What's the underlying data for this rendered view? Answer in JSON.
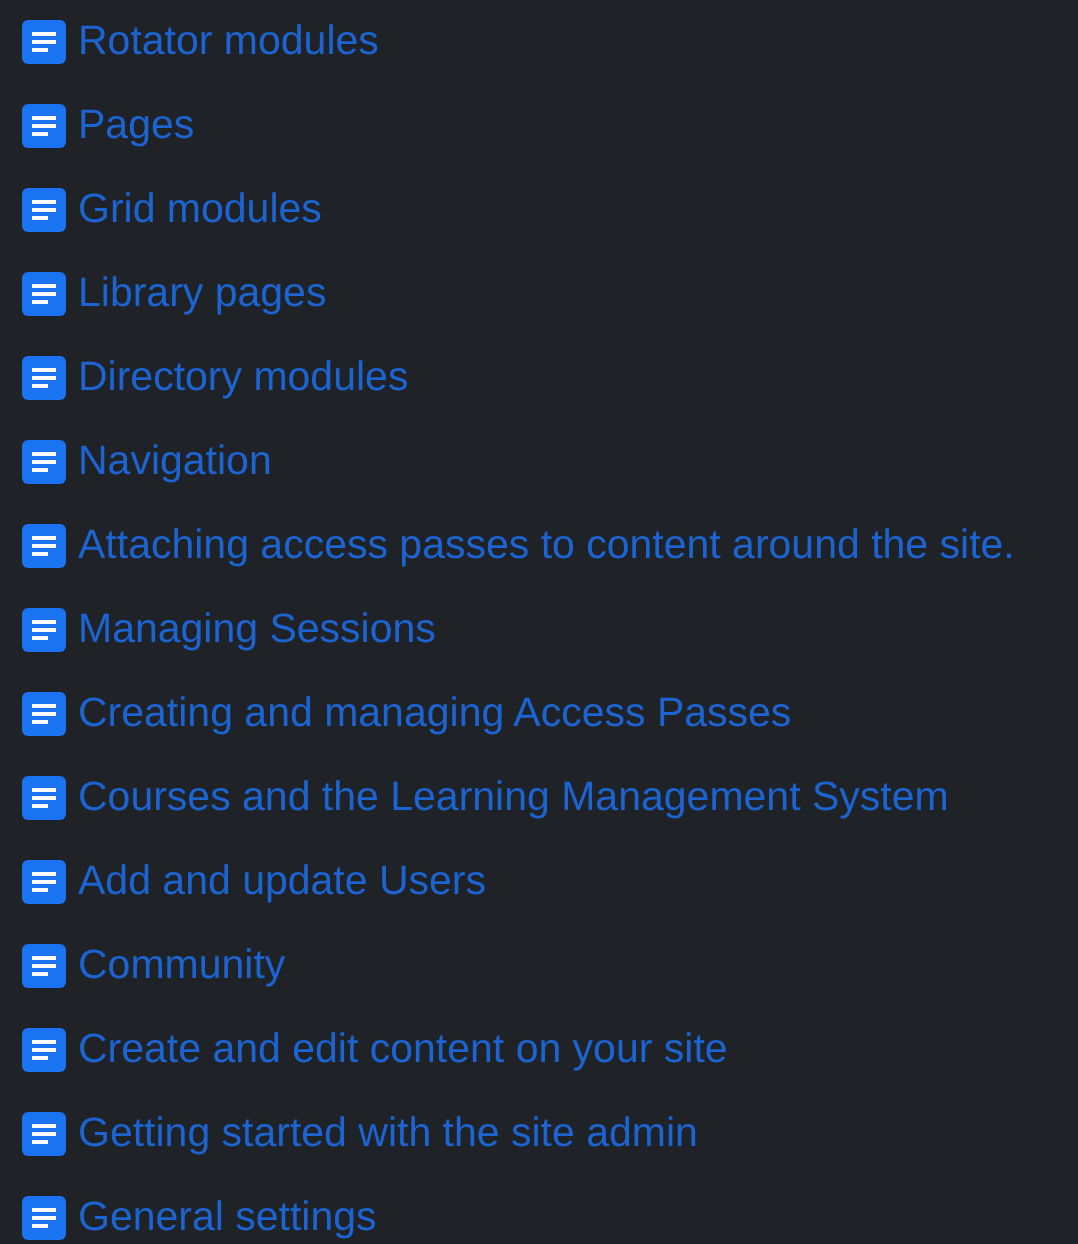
{
  "items": [
    {
      "label": "Rotator modules"
    },
    {
      "label": "Pages"
    },
    {
      "label": "Grid modules"
    },
    {
      "label": "Library pages"
    },
    {
      "label": "Directory modules"
    },
    {
      "label": "Navigation"
    },
    {
      "label": "Attaching access passes to content around the site."
    },
    {
      "label": "Managing Sessions"
    },
    {
      "label": "Creating and managing Access Passes"
    },
    {
      "label": "Courses and the Learning Management System"
    },
    {
      "label": "Add and update Users"
    },
    {
      "label": "Community"
    },
    {
      "label": "Create and edit content on your site"
    },
    {
      "label": "Getting started with the site admin"
    },
    {
      "label": "General settings"
    }
  ]
}
